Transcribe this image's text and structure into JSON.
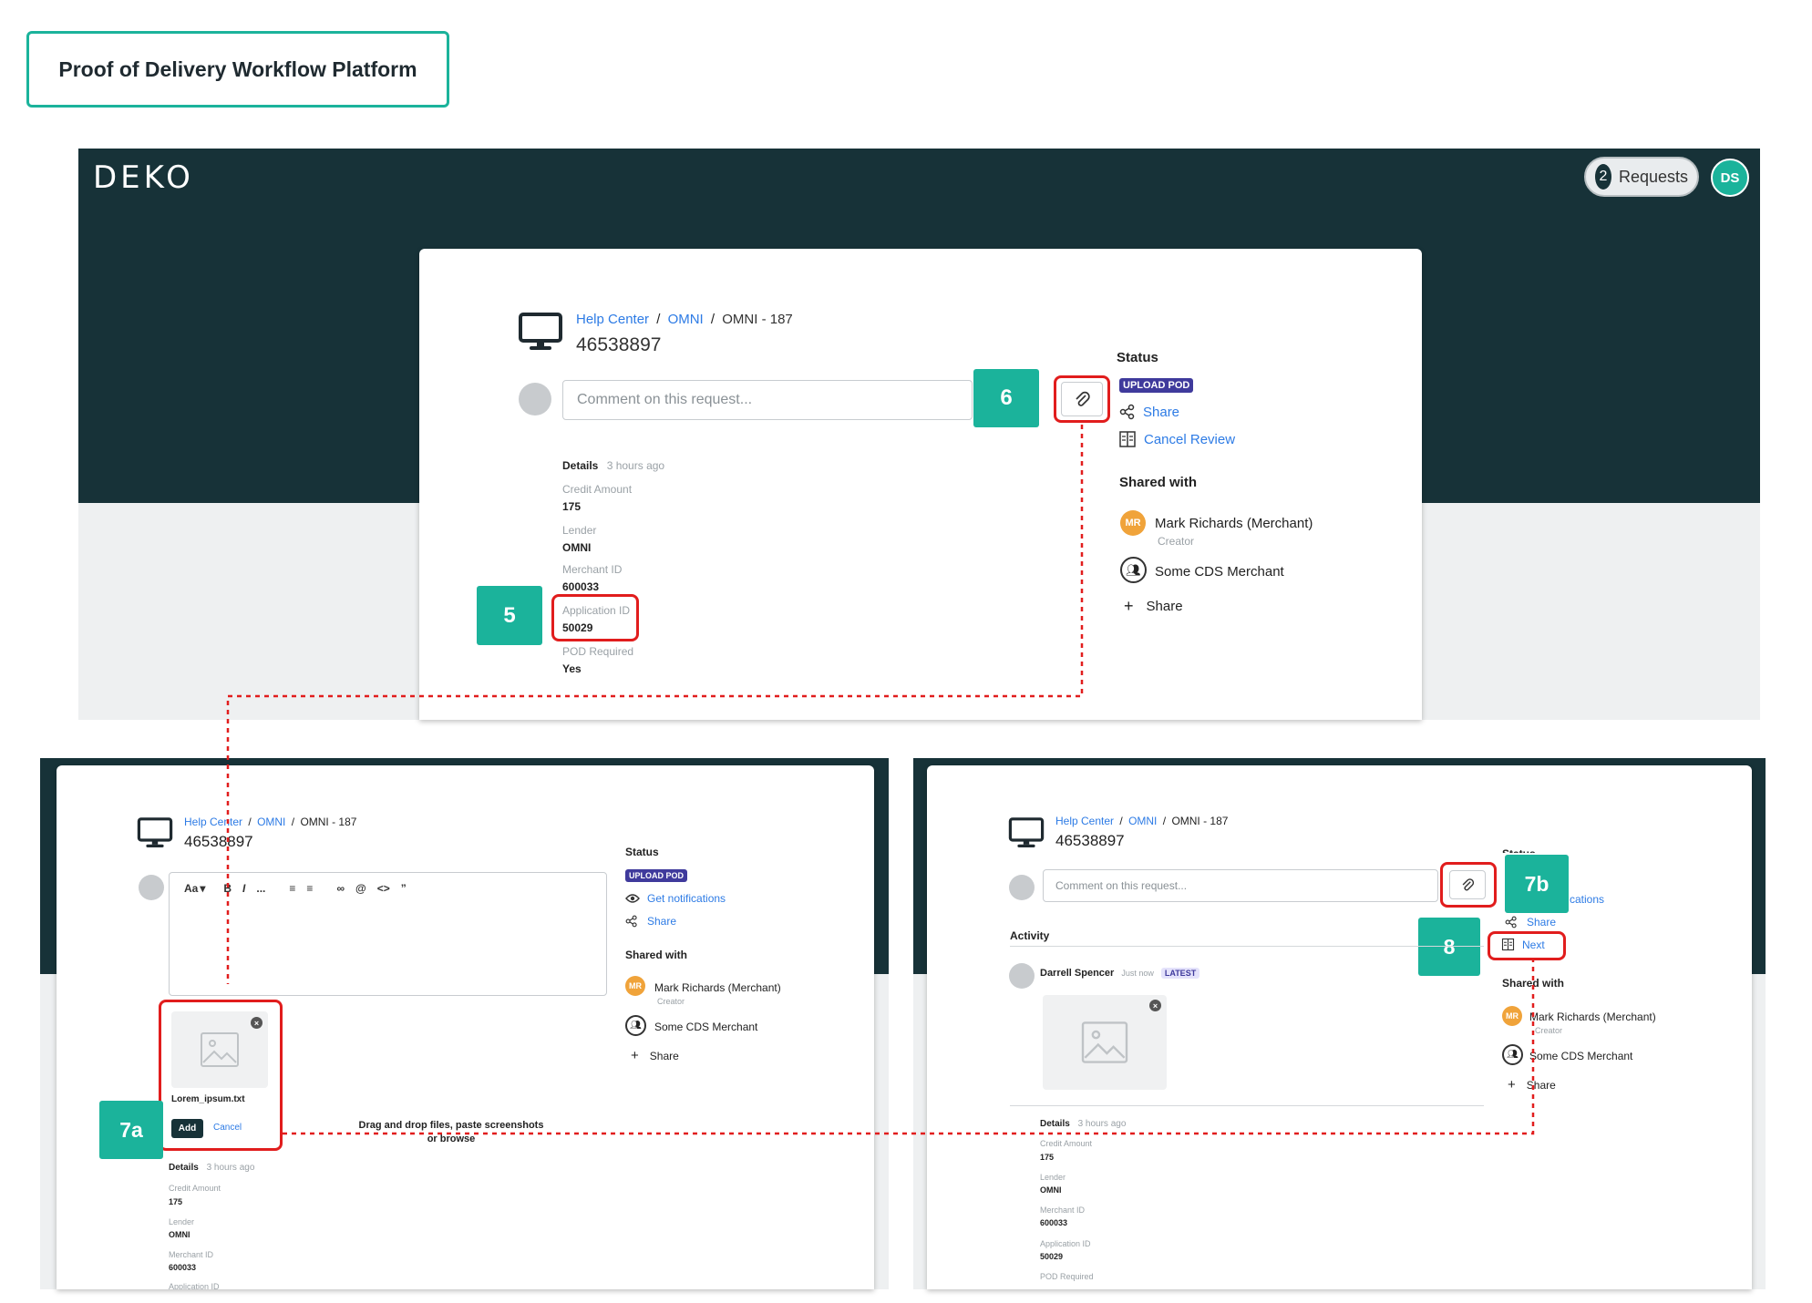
{
  "title": "Proof of Delivery Workflow Platform",
  "brand": {
    "logo": "DEKO",
    "requests_count": "2",
    "requests_label": "Requests",
    "user_initials": "DS"
  },
  "colors": {
    "teal": "#1bb39b",
    "dark": "#173238",
    "link": "#2d7be5",
    "badge": "#3f3a9c",
    "annotation_red": "#e11d1d",
    "merchant_avatar": "#f0a33a"
  },
  "breadcrumb": {
    "help_center": "Help Center",
    "omni": "OMNI",
    "ticket": "OMNI - 187",
    "sep": "/"
  },
  "request_id": "46538897",
  "comment_placeholder": "Comment on this request...",
  "status": {
    "heading": "Status",
    "badge": "UPLOAD POD",
    "share": "Share",
    "cancel_review": "Cancel Review",
    "get_notifications": "Get notifications",
    "next": "Next",
    "notif_partial": "cations",
    "status_partial": "Status"
  },
  "shared_with": {
    "heading": "Shared with",
    "merchant_initials": "MR",
    "merchant_name": "Mark Richards (Merchant)",
    "merchant_role": "Creator",
    "group_name": "Some CDS Merchant",
    "add_share": "Share"
  },
  "details": {
    "heading": "Details",
    "time": "3 hours ago",
    "fields": [
      {
        "label": "Credit Amount",
        "value": "175"
      },
      {
        "label": "Lender",
        "value": "OMNI"
      },
      {
        "label": "Merchant ID",
        "value": "600033"
      },
      {
        "label": "Application ID",
        "value": "50029"
      },
      {
        "label": "POD Required",
        "value": "Yes"
      }
    ]
  },
  "editor": {
    "text_style": "Aa",
    "bold": "B",
    "italic": "I",
    "more": "...",
    "mention": "@",
    "code": "<>",
    "quote": "”"
  },
  "upload": {
    "file_name": "Lorem_ipsum.txt",
    "add": "Add",
    "cancel": "Cancel",
    "drop_line1": "Drag and drop files, paste screenshots",
    "drop_line2": "or browse"
  },
  "activity": {
    "heading": "Activity",
    "user": "Darrell Spencer",
    "time": "Just now",
    "badge": "LATEST"
  },
  "steps": {
    "s5": "5",
    "s6": "6",
    "s7a": "7a",
    "s7b": "7b",
    "s8": "8"
  },
  "icons": [
    "desktop-icon",
    "paperclip-icon",
    "share-icon",
    "review-icon",
    "eye-icon",
    "group-icon",
    "plus-icon",
    "image-icon",
    "close-icon",
    "link-icon",
    "list-icon"
  ]
}
